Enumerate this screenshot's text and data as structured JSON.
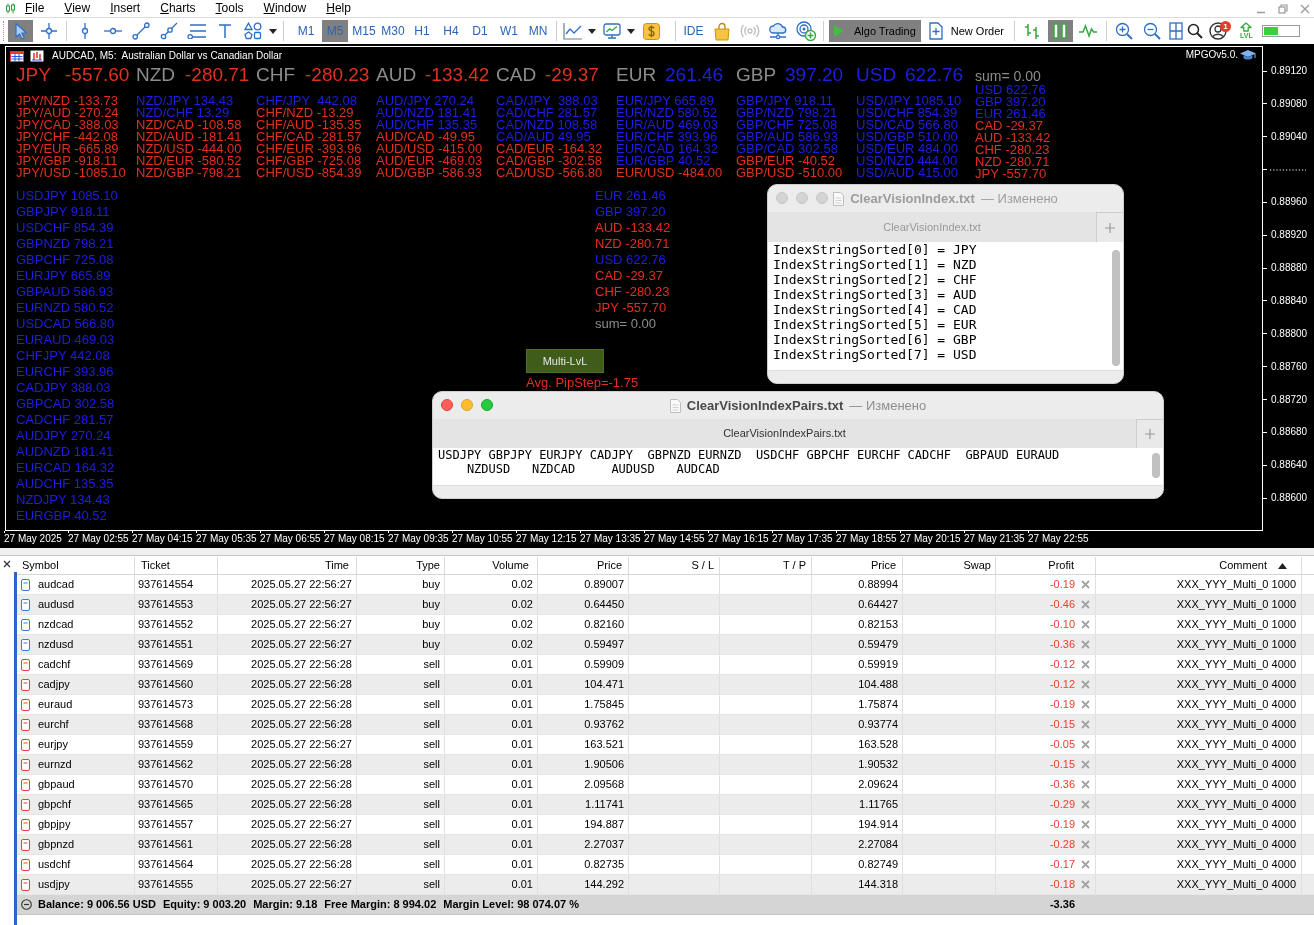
{
  "menu": {
    "items": [
      "File",
      "View",
      "Insert",
      "Charts",
      "Tools",
      "Window",
      "Help"
    ]
  },
  "toolbar": {
    "groups": [
      [
        {
          "kind": "cursor",
          "selected": true
        },
        {
          "kind": "crosshair",
          "selected": false
        }
      ],
      [
        {
          "kind": "vertical-line",
          "selected": false
        },
        {
          "kind": "horizontal-line",
          "selected": false
        },
        {
          "kind": "trend-line",
          "selected": false
        },
        {
          "kind": "ray-line",
          "selected": false
        },
        {
          "kind": "horizontal-lines",
          "selected": false
        },
        {
          "kind": "text-tool",
          "selected": false
        },
        {
          "kind": "shapes",
          "selected": false
        },
        {
          "kind": "dropdown",
          "selected": false
        }
      ],
      [
        {
          "kind": "timeframe",
          "label": "M1",
          "selected": false
        },
        {
          "kind": "timeframe",
          "label": "M5",
          "selected": true
        },
        {
          "kind": "timeframe",
          "label": "M15",
          "selected": false
        },
        {
          "kind": "timeframe",
          "label": "M30",
          "selected": false
        },
        {
          "kind": "timeframe",
          "label": "H1",
          "selected": false
        },
        {
          "kind": "timeframe",
          "label": "H4",
          "selected": false
        },
        {
          "kind": "timeframe",
          "label": "D1",
          "selected": false
        },
        {
          "kind": "timeframe",
          "label": "W1",
          "selected": false
        },
        {
          "kind": "timeframe",
          "label": "MN",
          "selected": false
        }
      ],
      [
        {
          "kind": "line-chart",
          "selected": false
        },
        {
          "kind": "dropdown",
          "selected": false
        },
        {
          "kind": "monitor-chart",
          "selected": false
        },
        {
          "kind": "dropdown",
          "selected": false
        },
        {
          "kind": "dollar",
          "selected": false
        }
      ],
      [
        {
          "kind": "ide",
          "label": "IDE",
          "selected": false
        },
        {
          "kind": "shopping-bag",
          "selected": false
        },
        {
          "kind": "broadcast",
          "selected": false
        },
        {
          "kind": "cloud",
          "selected": false
        },
        {
          "kind": "radar-plus",
          "selected": false
        }
      ],
      [
        {
          "kind": "algo",
          "label": "Algo Trading",
          "selected": true
        },
        {
          "kind": "new-order",
          "label": "New Order",
          "selected": false
        }
      ],
      [
        {
          "kind": "bar-chart",
          "selected": false
        },
        {
          "kind": "pause",
          "selected": true
        },
        {
          "kind": "wave",
          "selected": false
        }
      ],
      [
        {
          "kind": "zoom-in",
          "selected": false
        },
        {
          "kind": "zoom-out",
          "selected": false
        },
        {
          "kind": "tile-windows",
          "selected": false
        },
        {
          "kind": "search",
          "selected": false
        },
        {
          "kind": "account",
          "badge": "1",
          "selected": false
        },
        {
          "kind": "level-up",
          "label": "LVL",
          "selected": false
        },
        {
          "kind": "meter",
          "selected": false
        }
      ]
    ]
  },
  "chart": {
    "caption": "AUDCAD, M5:  Australian Dollar vs Canadian Dollar",
    "expert": "MPGOv5.0.",
    "strength": [
      {
        "currency": {
          "text": "JPY",
          "color": "#e2301f"
        },
        "value": {
          "text": "-557.60",
          "color": "#e2301f"
        }
      },
      {
        "currency": {
          "text": "NZD",
          "color": "#8c8c8c"
        },
        "value": {
          "text": "-280.71",
          "color": "#e2301f"
        }
      },
      {
        "currency": {
          "text": "CHF",
          "color": "#8c8c8c"
        },
        "value": {
          "text": "-280.23",
          "color": "#e2301f"
        }
      },
      {
        "currency": {
          "text": "AUD",
          "color": "#8c8c8c"
        },
        "value": {
          "text": "-133.42",
          "color": "#e2301f"
        }
      },
      {
        "currency": {
          "text": "CAD",
          "color": "#8c8c8c"
        },
        "value": {
          "text": "-29.37",
          "color": "#e2301f"
        }
      },
      {
        "currency": {
          "text": "EUR",
          "color": "#8c8c8c"
        },
        "value": {
          "text": "261.46",
          "color": "#1e1ee6"
        }
      },
      {
        "currency": {
          "text": "GBP",
          "color": "#8c8c8c"
        },
        "value": {
          "text": "397.20",
          "color": "#1e1ee6"
        }
      },
      {
        "currency": {
          "text": "USD",
          "color": "#1e1ee6"
        },
        "value": {
          "text": "622.76",
          "color": "#1e1ee6"
        }
      }
    ],
    "pair_columns": [
      [
        {
          "text": "JPY/NZD -133.73",
          "color": "#e2301f"
        },
        {
          "text": "JPY/AUD -270.24",
          "color": "#e2301f"
        },
        {
          "text": "JPY/CAD -388.03",
          "color": "#e2301f"
        },
        {
          "text": "JPY/CHF -442.08",
          "color": "#e2301f"
        },
        {
          "text": "JPY/EUR -665.89",
          "color": "#e2301f"
        },
        {
          "text": "JPY/GBP -918.11",
          "color": "#e2301f"
        },
        {
          "text": "JPY/USD -1085.10",
          "color": "#e2301f"
        }
      ],
      [
        {
          "text": "NZD/JPY 134.43",
          "color": "#1e1ee6"
        },
        {
          "text": "NZD/CHF 13.29",
          "color": "#1e1ee6"
        },
        {
          "text": "NZD/CAD -108.58",
          "color": "#e2301f"
        },
        {
          "text": "NZD/AUD -181.41",
          "color": "#e2301f"
        },
        {
          "text": "NZD/USD -444.00",
          "color": "#e2301f"
        },
        {
          "text": "NZD/EUR -580.52",
          "color": "#e2301f"
        },
        {
          "text": "NZD/GBP -798.21",
          "color": "#e2301f"
        }
      ],
      [
        {
          "text": "CHF/JPY  442.08",
          "color": "#1e1ee6"
        },
        {
          "text": "CHF/NZD -13.29",
          "color": "#e2301f"
        },
        {
          "text": "CHF/AUD -135.35",
          "color": "#e2301f"
        },
        {
          "text": "CHF/CAD -281.57",
          "color": "#e2301f"
        },
        {
          "text": "CHF/EUR -393.96",
          "color": "#e2301f"
        },
        {
          "text": "CHF/GBP -725.08",
          "color": "#e2301f"
        },
        {
          "text": "CHF/USD -854.39",
          "color": "#e2301f"
        }
      ],
      [
        {
          "text": "AUD/JPY 270.24",
          "color": "#1e1ee6"
        },
        {
          "text": "AUD/NZD 181.41",
          "color": "#1e1ee6"
        },
        {
          "text": "AUD/CHF 135.35",
          "color": "#1e1ee6"
        },
        {
          "text": "AUD/CAD -49.95",
          "color": "#e2301f"
        },
        {
          "text": "AUD/USD -415.00",
          "color": "#e2301f"
        },
        {
          "text": "AUD/EUR -469.03",
          "color": "#e2301f"
        },
        {
          "text": "AUD/GBP -586.93",
          "color": "#e2301f"
        }
      ],
      [
        {
          "text": "CAD/JPY  388.03",
          "color": "#1e1ee6"
        },
        {
          "text": "CAD/CHF 281.57",
          "color": "#1e1ee6"
        },
        {
          "text": "CAD/NZD 108.58",
          "color": "#1e1ee6"
        },
        {
          "text": "CAD/AUD 49.95",
          "color": "#1e1ee6"
        },
        {
          "text": "CAD/EUR -164.32",
          "color": "#e2301f"
        },
        {
          "text": "CAD/GBP -302.58",
          "color": "#e2301f"
        },
        {
          "text": "CAD/USD -566.80",
          "color": "#e2301f"
        }
      ],
      [
        {
          "text": "EUR/JPY 665.89",
          "color": "#1e1ee6"
        },
        {
          "text": "EUR/NZD 580.52",
          "color": "#1e1ee6"
        },
        {
          "text": "EUR/AUD 469.03",
          "color": "#1e1ee6"
        },
        {
          "text": "EUR/CHF 393.96",
          "color": "#1e1ee6"
        },
        {
          "text": "EUR/CAD 164.32",
          "color": "#1e1ee6"
        },
        {
          "text": "EUR/GBP 40.52",
          "color": "#1e1ee6"
        },
        {
          "text": "EUR/USD -484.00",
          "color": "#e2301f"
        }
      ],
      [
        {
          "text": "GBP/JPY 918.11",
          "color": "#1e1ee6"
        },
        {
          "text": "GBP/NZD 798.21",
          "color": "#1e1ee6"
        },
        {
          "text": "GBP/CHF 725.08",
          "color": "#1e1ee6"
        },
        {
          "text": "GBP/AUD 586.93",
          "color": "#1e1ee6"
        },
        {
          "text": "GBP/CAD 302.58",
          "color": "#1e1ee6"
        },
        {
          "text": "GBP/EUR -40.52",
          "color": "#e2301f"
        },
        {
          "text": "GBP/USD -510.00",
          "color": "#e2301f"
        }
      ],
      [
        {
          "text": "USD/JPY 1085.10",
          "color": "#1e1ee6"
        },
        {
          "text": "USD/CHF 854.39",
          "color": "#1e1ee6"
        },
        {
          "text": "USD/CAD 566.80",
          "color": "#1e1ee6"
        },
        {
          "text": "USD/GBP 510.00",
          "color": "#1e1ee6"
        },
        {
          "text": "USD/EUR 484.00",
          "color": "#1e1ee6"
        },
        {
          "text": "USD/NZD 444.00",
          "color": "#1e1ee6"
        },
        {
          "text": "USD/AUD 415.00",
          "color": "#1e1ee6"
        }
      ]
    ],
    "sorted_list": {
      "sum": "sum= 0.00",
      "items": [
        {
          "text": "USD 622.76",
          "color": "#1e1ee6"
        },
        {
          "text": "GBP 397.20",
          "color": "#1e1ee6"
        },
        {
          "text": "EUR 261.46",
          "color": "#1e1ee6"
        },
        {
          "text": "CAD -29.37",
          "color": "#e2301f"
        },
        {
          "text": "AUD -133.42",
          "color": "#e2301f"
        },
        {
          "text": "CHF -280.23",
          "color": "#e2301f"
        },
        {
          "text": "NZD -280.71",
          "color": "#e2301f"
        },
        {
          "text": "JPY -557.70",
          "color": "#e2301f"
        }
      ]
    },
    "pair_ranking": [
      {
        "text": "USDJPY 1085.10",
        "color": "#1e1ee6"
      },
      {
        "text": "GBPJPY 918.11",
        "color": "#1e1ee6"
      },
      {
        "text": "USDCHF 854.39",
        "color": "#1e1ee6"
      },
      {
        "text": "GBPNZD 798.21",
        "color": "#1e1ee6"
      },
      {
        "text": "GBPCHF 725.08",
        "color": "#1e1ee6"
      },
      {
        "text": "EURJPY 665.89",
        "color": "#1e1ee6"
      },
      {
        "text": "GBPAUD 586.93",
        "color": "#1e1ee6"
      },
      {
        "text": "EURNZD 580.52",
        "color": "#1e1ee6"
      },
      {
        "text": "USDCAD 566.80",
        "color": "#1e1ee6"
      },
      {
        "text": "EURAUD 469.03",
        "color": "#1e1ee6"
      },
      {
        "text": "CHFJPY 442.08",
        "color": "#1e1ee6"
      },
      {
        "text": "EURCHF 393.96",
        "color": "#1e1ee6"
      },
      {
        "text": "CADJPY 388.03",
        "color": "#1e1ee6"
      },
      {
        "text": "GBPCAD 302.58",
        "color": "#1e1ee6"
      },
      {
        "text": "CADCHF 281.57",
        "color": "#1e1ee6"
      },
      {
        "text": "AUDJPY 270.24",
        "color": "#1e1ee6"
      },
      {
        "text": "AUDNZD 181.41",
        "color": "#1e1ee6"
      },
      {
        "text": "EURCAD 164.32",
        "color": "#1e1ee6"
      },
      {
        "text": "AUDCHF 135.35",
        "color": "#1e1ee6"
      },
      {
        "text": "NZDJPY 134.43",
        "color": "#1e1ee6"
      },
      {
        "text": "EURGBP 40.52",
        "color": "#1e1ee6"
      }
    ],
    "currency_list": {
      "items": [
        {
          "text": "EUR 261.46",
          "color": "#1e1ee6"
        },
        {
          "text": "GBP 397.20",
          "color": "#1e1ee6"
        },
        {
          "text": "AUD -133.42",
          "color": "#e2301f"
        },
        {
          "text": "NZD -280.71",
          "color": "#e2301f"
        },
        {
          "text": "USD 622.76",
          "color": "#1e1ee6"
        },
        {
          "text": "CAD -29.37",
          "color": "#e2301f"
        },
        {
          "text": "CHF -280.23",
          "color": "#e2301f"
        },
        {
          "text": "JPY -557.70",
          "color": "#e2301f"
        }
      ],
      "sum": "sum= 0.00"
    },
    "multi_button": "Multi-LvL",
    "pip_step": "Avg. PipStep=-1.75",
    "price_axis": [
      {
        "kind": "label",
        "text": "0.89120"
      },
      {
        "kind": "label",
        "text": "0.89080"
      },
      {
        "kind": "label",
        "text": "0.89040"
      },
      {
        "kind": "marker"
      },
      {
        "kind": "label",
        "text": "0.88960"
      },
      {
        "kind": "label",
        "text": "0.88920"
      },
      {
        "kind": "label",
        "text": "0.88880"
      },
      {
        "kind": "label",
        "text": "0.88840"
      },
      {
        "kind": "label",
        "text": "0.88800"
      },
      {
        "kind": "label",
        "text": "0.88760"
      },
      {
        "kind": "label",
        "text": "0.88720"
      },
      {
        "kind": "label",
        "text": "0.88680"
      },
      {
        "kind": "label",
        "text": "0.88640"
      },
      {
        "kind": "label",
        "text": "0.88600"
      }
    ],
    "time_axis": [
      "27 May 2025",
      "27 May 02:55",
      "27 May 04:15",
      "27 May 05:35",
      "27 May 06:55",
      "27 May 08:15",
      "27 May 09:35",
      "27 May 10:55",
      "27 May 12:15",
      "27 May 13:35",
      "27 May 14:55",
      "27 May 16:15",
      "27 May 17:35",
      "27 May 18:55",
      "27 May 20:15",
      "27 May 21:35",
      "27 May 22:55"
    ]
  },
  "windows": [
    {
      "title": "ClearVisionIndex.txt",
      "status": "— Изменено",
      "tab": "ClearVisionIndex.txt",
      "active": false,
      "lines": [
        "IndexStringSorted[0] = JPY",
        "IndexStringSorted[1] = NZD",
        "IndexStringSorted[2] = CHF",
        "IndexStringSorted[3] = AUD",
        "IndexStringSorted[4] = CAD",
        "IndexStringSorted[5] = EUR",
        "IndexStringSorted[6] = GBP",
        "IndexStringSorted[7] = USD"
      ]
    },
    {
      "title": "ClearVisionIndexPairs.txt",
      "status": "— Изменено",
      "tab": "ClearVisionIndexPairs.txt",
      "active": true,
      "lines": [
        "USDJPY GBPJPY EURJPY CADJPY  GBPNZD EURNZD  USDCHF GBPCHF EURCHF CADCHF  GBPAUD EURAUD",
        "    NZDUSD   NZDCAD     AUDUSD   AUDCAD"
      ]
    }
  ],
  "positions": {
    "columns": [
      {
        "label": "Symbol",
        "sorted": false
      },
      {
        "label": "Ticket",
        "sorted": false
      },
      {
        "label": "Time",
        "sorted": false
      },
      {
        "label": "Type",
        "sorted": false
      },
      {
        "label": "Volume",
        "sorted": false
      },
      {
        "label": "Price",
        "sorted": false
      },
      {
        "label": "S / L",
        "sorted": false
      },
      {
        "label": "T / P",
        "sorted": false
      },
      {
        "label": "Price",
        "sorted": false
      },
      {
        "label": "Swap",
        "sorted": false
      },
      {
        "label": "Profit",
        "sorted": false
      },
      {
        "label": "Comment",
        "sorted": true
      }
    ],
    "rows": [
      {
        "kind": "buy",
        "symbol": "audcad",
        "ticket": "937614554",
        "time": "2025.05.27 22:56:27",
        "type": "buy",
        "volume": "0.02",
        "price": "0.89007",
        "current_price": "0.88994",
        "profit": "-0.19",
        "comment": "XXX_YYY_Multi_0 1000"
      },
      {
        "kind": "buy",
        "symbol": "audusd",
        "ticket": "937614553",
        "time": "2025.05.27 22:56:27",
        "type": "buy",
        "volume": "0.02",
        "price": "0.64450",
        "current_price": "0.64427",
        "profit": "-0.46",
        "comment": "XXX_YYY_Multi_0 1000"
      },
      {
        "kind": "buy",
        "symbol": "nzdcad",
        "ticket": "937614552",
        "time": "2025.05.27 22:56:27",
        "type": "buy",
        "volume": "0.02",
        "price": "0.82160",
        "current_price": "0.82153",
        "profit": "-0.10",
        "comment": "XXX_YYY_Multi_0 1000"
      },
      {
        "kind": "buy",
        "symbol": "nzdusd",
        "ticket": "937614551",
        "time": "2025.05.27 22:56:27",
        "type": "buy",
        "volume": "0.02",
        "price": "0.59497",
        "current_price": "0.59479",
        "profit": "-0.36",
        "comment": "XXX_YYY_Multi_0 1000"
      },
      {
        "kind": "sell",
        "symbol": "cadchf",
        "ticket": "937614569",
        "time": "2025.05.27 22:56:28",
        "type": "sell",
        "volume": "0.01",
        "price": "0.59909",
        "current_price": "0.59919",
        "profit": "-0.12",
        "comment": "XXX_YYY_Multi_0 4000"
      },
      {
        "kind": "sell",
        "symbol": "cadjpy",
        "ticket": "937614560",
        "time": "2025.05.27 22:56:28",
        "type": "sell",
        "volume": "0.01",
        "price": "104.471",
        "current_price": "104.488",
        "profit": "-0.12",
        "comment": "XXX_YYY_Multi_0 4000"
      },
      {
        "kind": "sell",
        "symbol": "euraud",
        "ticket": "937614573",
        "time": "2025.05.27 22:56:28",
        "type": "sell",
        "volume": "0.01",
        "price": "1.75845",
        "current_price": "1.75874",
        "profit": "-0.19",
        "comment": "XXX_YYY_Multi_0 4000"
      },
      {
        "kind": "sell",
        "symbol": "eurchf",
        "ticket": "937614568",
        "time": "2025.05.27 22:56:28",
        "type": "sell",
        "volume": "0.01",
        "price": "0.93762",
        "current_price": "0.93774",
        "profit": "-0.15",
        "comment": "XXX_YYY_Multi_0 4000"
      },
      {
        "kind": "sell",
        "symbol": "eurjpy",
        "ticket": "937614559",
        "time": "2025.05.27 22:56:27",
        "type": "sell",
        "volume": "0.01",
        "price": "163.521",
        "current_price": "163.528",
        "profit": "-0.05",
        "comment": "XXX_YYY_Multi_0 4000"
      },
      {
        "kind": "sell",
        "symbol": "eurnzd",
        "ticket": "937614562",
        "time": "2025.05.27 22:56:28",
        "type": "sell",
        "volume": "0.01",
        "price": "1.90506",
        "current_price": "1.90532",
        "profit": "-0.15",
        "comment": "XXX_YYY_Multi_0 4000"
      },
      {
        "kind": "sell",
        "symbol": "gbpaud",
        "ticket": "937614570",
        "time": "2025.05.27 22:56:28",
        "type": "sell",
        "volume": "0.01",
        "price": "2.09568",
        "current_price": "2.09624",
        "profit": "-0.36",
        "comment": "XXX_YYY_Multi_0 4000"
      },
      {
        "kind": "sell",
        "symbol": "gbpchf",
        "ticket": "937614565",
        "time": "2025.05.27 22:56:28",
        "type": "sell",
        "volume": "0.01",
        "price": "1.11741",
        "current_price": "1.11765",
        "profit": "-0.29",
        "comment": "XXX_YYY_Multi_0 4000"
      },
      {
        "kind": "sell",
        "symbol": "gbpjpy",
        "ticket": "937614557",
        "time": "2025.05.27 22:56:27",
        "type": "sell",
        "volume": "0.01",
        "price": "194.887",
        "current_price": "194.914",
        "profit": "-0.19",
        "comment": "XXX_YYY_Multi_0 4000"
      },
      {
        "kind": "sell",
        "symbol": "gbpnzd",
        "ticket": "937614561",
        "time": "2025.05.27 22:56:28",
        "type": "sell",
        "volume": "0.01",
        "price": "2.27037",
        "current_price": "2.27084",
        "profit": "-0.28",
        "comment": "XXX_YYY_Multi_0 4000"
      },
      {
        "kind": "sell",
        "symbol": "usdchf",
        "ticket": "937614564",
        "time": "2025.05.27 22:56:28",
        "type": "sell",
        "volume": "0.01",
        "price": "0.82735",
        "current_price": "0.82749",
        "profit": "-0.17",
        "comment": "XXX_YYY_Multi_0 4000"
      },
      {
        "kind": "sell",
        "symbol": "usdjpy",
        "ticket": "937614555",
        "time": "2025.05.27 22:56:27",
        "type": "sell",
        "volume": "0.01",
        "price": "144.292",
        "current_price": "144.318",
        "profit": "-0.18",
        "comment": "XXX_YYY_Multi_0 4000"
      }
    ],
    "summary": {
      "items": [
        "Balance: 9 006.56 USD",
        "Equity: 9 003.20",
        "Margin: 9.18",
        "Free Margin: 8 994.02",
        "Margin Level: 98 074.07 %"
      ],
      "profit": "-3.36"
    }
  }
}
